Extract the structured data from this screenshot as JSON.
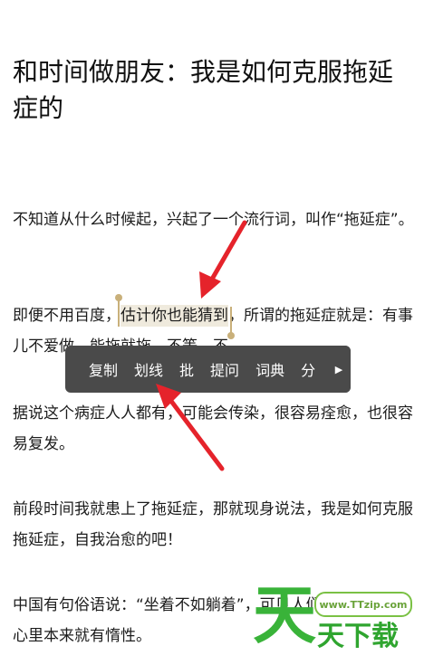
{
  "article": {
    "title": "和时间做朋友：我是如何克服拖延症的",
    "p1": "不知道从什么时候起，兴起了一个流行词，叫作“拖延症”。",
    "p2_before": "即便不用百度，",
    "p2_highlight": "估计你也能猜到",
    "p2_after": "，所谓的拖延症就是：有事儿不爱做，能拖就拖，不等，不",
    "p3": "据说这个病症人人都有，可能会传染，很容易痊愈，也很容易复发。",
    "p4": "前段时间我就患上了拖延症，那就现身说法，我是如何克服拖延症，自我治愈的吧！",
    "p5_a": "中国有句俗语说：“坐着不如躺着”，可见人们内",
    "p5_b": "心里本来就有惰性。"
  },
  "context_menu": {
    "items": [
      "复制",
      "划线",
      "批",
      "提问",
      "词典",
      "分"
    ],
    "more_icon": "triangle-right-icon"
  },
  "watermark": {
    "badge": "www.TTzip.com",
    "logo": "天",
    "text": "天下载"
  },
  "colors": {
    "highlight": "#efeadd",
    "handle": "#c9b07a",
    "menu_bg": "#4a4a4a",
    "arrow": "#e5232b"
  }
}
